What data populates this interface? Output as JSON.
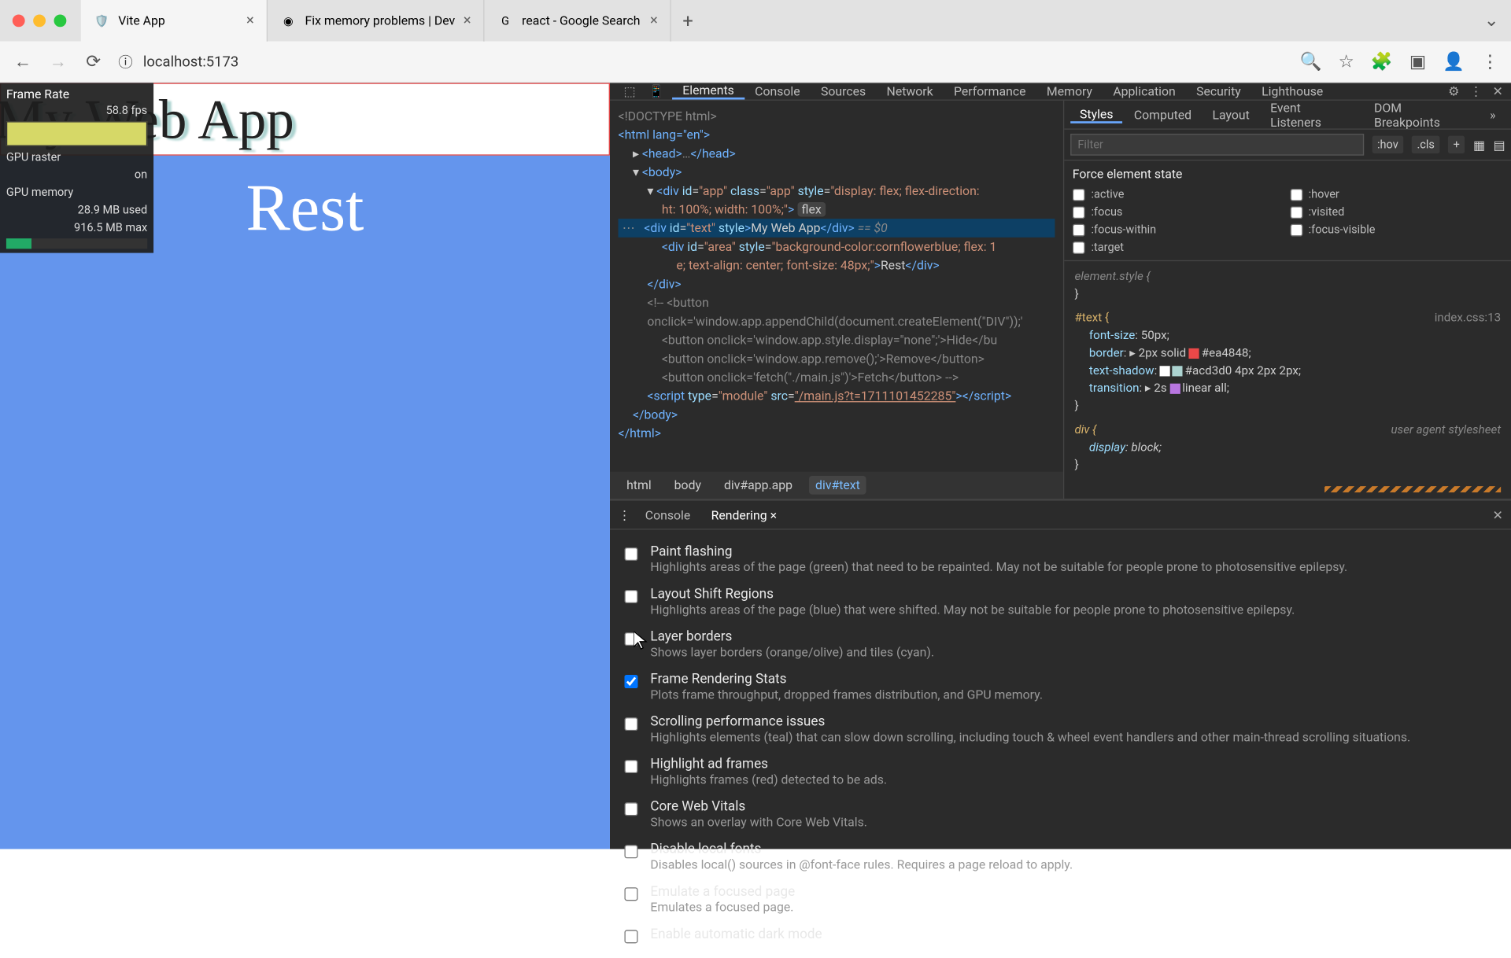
{
  "tabs": [
    {
      "title": "Vite App",
      "active": true,
      "icon": "🛡️"
    },
    {
      "title": "Fix memory problems | Dev",
      "active": false,
      "icon": "◉"
    },
    {
      "title": "react - Google Search",
      "active": false,
      "icon": "G"
    }
  ],
  "url": "localhost:5173",
  "page": {
    "title": "My Web App",
    "rest": "Rest"
  },
  "overlay": {
    "framerate_label": "Frame Rate",
    "fps": "58.8 fps",
    "raster_label": "GPU raster",
    "raster_val": "on",
    "mem_label": "GPU memory",
    "mem_used": "28.9 MB used",
    "mem_max": "916.5 MB max"
  },
  "devtabs": [
    "Elements",
    "Console",
    "Sources",
    "Network",
    "Performance",
    "Memory",
    "Application",
    "Security",
    "Lighthouse"
  ],
  "devtab_active": "Elements",
  "dom": {
    "l1": "<!DOCTYPE html>",
    "l2": "<html lang=\"en\">",
    "l3": "<head>…</head>",
    "l4": "<body>",
    "l5a": "<div id=\"app\" class=\"app\" style=\"display: flex; flex-direction:",
    "l5b": "ht: 100%; width: 100%;\">",
    "l5flex": "flex",
    "l6": "<div id=\"text\" style>My Web App</div> == $0",
    "l7": "<div id=\"area\" style=\"background-color:cornflowerblue; flex: 1",
    "l7b": "e; text-align: center; font-size: 48px;\">Rest</div>",
    "l8": "</div>",
    "l9": "<!-- <button",
    "l10": "onclick='window.app.appendChild(document.createElement(\"DIV\"));'",
    "l11": "<button onclick='window.app.style.display=\"none\";'>Hide</bu",
    "l12": "<button onclick='window.app.remove();'>Remove</button>",
    "l13": "<button onclick='fetch(\"./main.js\")'>Fetch</button> -->",
    "l14": "<script type=\"module\" src=\"/main.js?t=1711101452285\"></scr ipt>",
    "l15": "</body>",
    "l16": "</html>"
  },
  "breadcrumb": [
    "html",
    "body",
    "div#app.app",
    "div#text"
  ],
  "styles_tabs": [
    "Styles",
    "Computed",
    "Layout",
    "Event Listeners",
    "DOM Breakpoints"
  ],
  "filter_placeholder": "Filter",
  "filter_btns": [
    ":hov",
    ".cls",
    "+"
  ],
  "force_title": "Force element state",
  "force_states": [
    ":active",
    ":hover",
    ":focus",
    ":visited",
    ":focus-within",
    ":focus-visible",
    ":target"
  ],
  "css": {
    "elstyle": "element.style {",
    "sel": "#text {",
    "src": "index.css:13",
    "p1": "font-size",
    "v1": "50px;",
    "p2": "border",
    "v2": "2px solid",
    "v2c": "#ea4848;",
    "p3": "text-shadow",
    "v3": "#acd3d0 4px 2px 2px;",
    "p4": "transition",
    "v4": "2s",
    "v4b": "linear all;",
    "close": "}",
    "div": "div {",
    "divsrc": "user agent stylesheet",
    "divp": "display",
    "divv": "block;"
  },
  "drawer_tabs": [
    "Console",
    "Rendering"
  ],
  "drawer_active": "Rendering",
  "rendering": [
    {
      "t": "Paint flashing",
      "d": "Highlights areas of the page (green) that need to be repainted. May not be suitable for people prone to photosensitive epilepsy.",
      "c": false
    },
    {
      "t": "Layout Shift Regions",
      "d": "Highlights areas of the page (blue) that were shifted. May not be suitable for people prone to photosensitive epilepsy.",
      "c": false
    },
    {
      "t": "Layer borders",
      "d": "Shows layer borders (orange/olive) and tiles (cyan).",
      "c": false
    },
    {
      "t": "Frame Rendering Stats",
      "d": "Plots frame throughput, dropped frames distribution, and GPU memory.",
      "c": true
    },
    {
      "t": "Scrolling performance issues",
      "d": "Highlights elements (teal) that can slow down scrolling, including touch & wheel event handlers and other main-thread scrolling situations.",
      "c": false
    },
    {
      "t": "Highlight ad frames",
      "d": "Highlights frames (red) detected to be ads.",
      "c": false
    },
    {
      "t": "Core Web Vitals",
      "d": "Shows an overlay with Core Web Vitals.",
      "c": false
    },
    {
      "t": "Disable local fonts",
      "d": "Disables local() sources in @font-face rules. Requires a page reload to apply.",
      "c": false
    },
    {
      "t": "Emulate a focused page",
      "d": "Emulates a focused page.",
      "c": false
    },
    {
      "t": "Enable automatic dark mode",
      "d": "",
      "c": false
    }
  ]
}
